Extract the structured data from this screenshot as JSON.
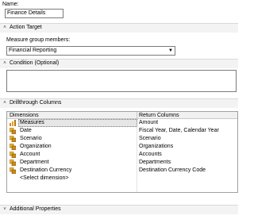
{
  "name": {
    "label": "Name:",
    "value": "Finance Details"
  },
  "action_target": {
    "header": "Action Target",
    "members_label": "Measure group members:",
    "selected": "Financial Reporting"
  },
  "condition": {
    "header": "Condition (Optional)"
  },
  "drillthrough": {
    "header": "Drillthrough Columns",
    "col_dimensions": "Dimensions",
    "col_return": "Return Columns",
    "rows": [
      {
        "dimension": "Measures",
        "returns": "Amount",
        "icon": "measures-icon"
      },
      {
        "dimension": "Date",
        "returns": "Fiscal Year, Date, Calendar Year",
        "icon": "dimension-icon"
      },
      {
        "dimension": "Scenario",
        "returns": "Scenario",
        "icon": "dimension-icon"
      },
      {
        "dimension": "Organization",
        "returns": "Organizations",
        "icon": "dimension-icon"
      },
      {
        "dimension": "Account",
        "returns": "Accounts",
        "icon": "dimension-icon"
      },
      {
        "dimension": "Department",
        "returns": "Departments",
        "icon": "dimension-icon"
      },
      {
        "dimension": "Destination Currency",
        "returns": "Destination Currency Code",
        "icon": "dimension-icon"
      }
    ],
    "select_placeholder": "<Select dimension>"
  },
  "additional": {
    "header": "Additional Properties"
  },
  "colors": {
    "section_bg": "#f3f3f3",
    "selected_row": "#e6e6e6",
    "border": "#7a7a7a"
  }
}
